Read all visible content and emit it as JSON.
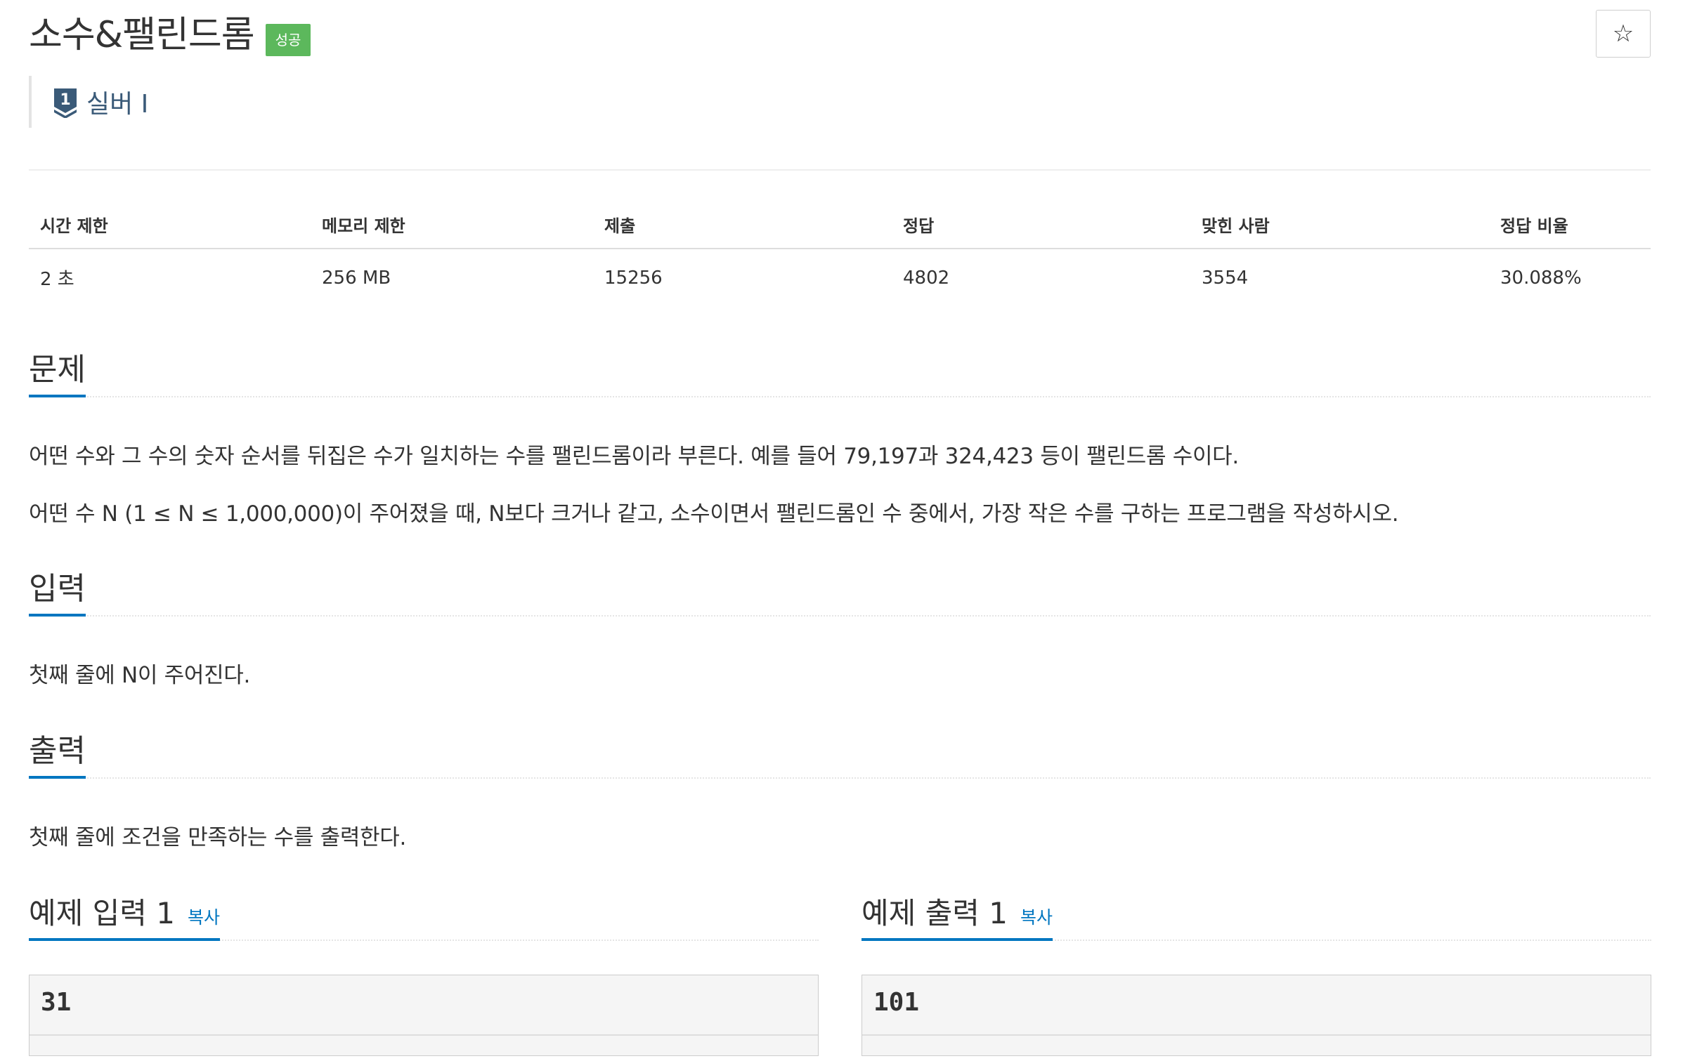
{
  "problem": {
    "title": "소수&팰린드롬",
    "status_badge": "성공",
    "star_label": "☆",
    "tier": {
      "number": "1",
      "label": "실버 I",
      "icon": "silver-tier-icon",
      "color": "#3a5a78"
    }
  },
  "info_table": {
    "headers": [
      "시간 제한",
      "메모리 제한",
      "제출",
      "정답",
      "맞힌 사람",
      "정답 비율"
    ],
    "values": [
      "2 초",
      "256 MB",
      "15256",
      "4802",
      "3554",
      "30.088%"
    ]
  },
  "sections": {
    "problem": {
      "heading": "문제",
      "paragraphs": [
        "어떤 수와 그 수의 숫자 순서를 뒤집은 수가 일치하는 수를 팰린드롬이라 부른다. 예를 들어 79,197과 324,423 등이 팰린드롬 수이다.",
        "어떤 수 N (1 ≤ N ≤ 1,000,000)이 주어졌을 때, N보다 크거나 같고, 소수이면서 팰린드롬인 수 중에서, 가장 작은 수를 구하는 프로그램을 작성하시오."
      ]
    },
    "input": {
      "heading": "입력",
      "text": "첫째 줄에 N이 주어진다."
    },
    "output": {
      "heading": "출력",
      "text": "첫째 줄에 조건을 만족하는 수를 출력한다."
    }
  },
  "examples": {
    "input": {
      "heading": "예제 입력 1",
      "copy_label": "복사",
      "value": "31"
    },
    "output": {
      "heading": "예제 출력 1",
      "copy_label": "복사",
      "value": "101"
    }
  },
  "colors": {
    "badge_success": "#5cb85c",
    "accent": "#0076c0",
    "text": "#333333"
  }
}
